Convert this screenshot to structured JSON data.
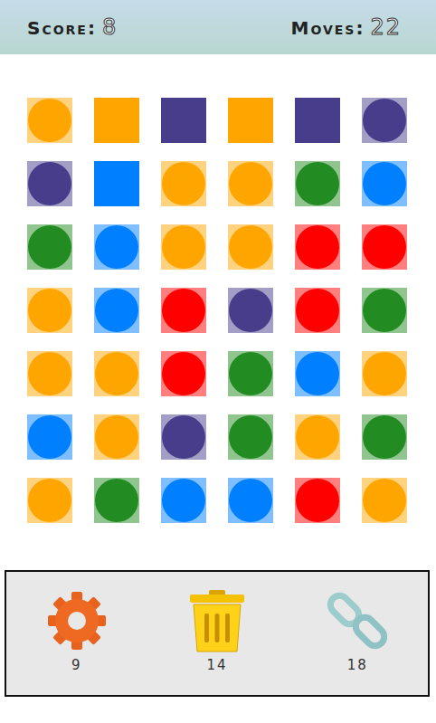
{
  "header": {
    "score": {
      "label": "Score:",
      "value": "8"
    },
    "moves": {
      "label": "Moves:",
      "value": "22"
    }
  },
  "board": {
    "rows": [
      [
        {
          "kind": "circle",
          "color": "#ffa500"
        },
        {
          "kind": "square",
          "color": "#ffa500"
        },
        {
          "kind": "square",
          "color": "#483d8b"
        },
        {
          "kind": "square",
          "color": "#ffa500"
        },
        {
          "kind": "square",
          "color": "#483d8b"
        },
        {
          "kind": "circle",
          "color": "#483d8b"
        }
      ],
      [
        {
          "kind": "circle",
          "color": "#483d8b"
        },
        {
          "kind": "square",
          "color": "#007fff"
        },
        {
          "kind": "circle",
          "color": "#ffa500"
        },
        {
          "kind": "circle",
          "color": "#ffa500"
        },
        {
          "kind": "circle",
          "color": "#228b22"
        },
        {
          "kind": "circle",
          "color": "#007fff"
        }
      ],
      [
        {
          "kind": "circle",
          "color": "#228b22"
        },
        {
          "kind": "circle",
          "color": "#007fff"
        },
        {
          "kind": "circle",
          "color": "#ffa500"
        },
        {
          "kind": "circle",
          "color": "#ffa500"
        },
        {
          "kind": "circle",
          "color": "#ff0000"
        },
        {
          "kind": "circle",
          "color": "#ff0000"
        }
      ],
      [
        {
          "kind": "circle",
          "color": "#ffa500"
        },
        {
          "kind": "circle",
          "color": "#007fff"
        },
        {
          "kind": "circle",
          "color": "#ff0000"
        },
        {
          "kind": "circle",
          "color": "#483d8b"
        },
        {
          "kind": "circle",
          "color": "#ff0000"
        },
        {
          "kind": "circle",
          "color": "#228b22"
        }
      ],
      [
        {
          "kind": "circle",
          "color": "#ffa500"
        },
        {
          "kind": "circle",
          "color": "#ffa500"
        },
        {
          "kind": "circle",
          "color": "#ff0000"
        },
        {
          "kind": "circle",
          "color": "#228b22"
        },
        {
          "kind": "circle",
          "color": "#007fff"
        },
        {
          "kind": "circle",
          "color": "#ffa500"
        }
      ],
      [
        {
          "kind": "circle",
          "color": "#007fff"
        },
        {
          "kind": "circle",
          "color": "#ffa500"
        },
        {
          "kind": "circle",
          "color": "#483d8b"
        },
        {
          "kind": "circle",
          "color": "#228b22"
        },
        {
          "kind": "circle",
          "color": "#ffa500"
        },
        {
          "kind": "circle",
          "color": "#228b22"
        }
      ],
      [
        {
          "kind": "circle",
          "color": "#ffa500"
        },
        {
          "kind": "circle",
          "color": "#228b22"
        },
        {
          "kind": "circle",
          "color": "#007fff"
        },
        {
          "kind": "circle",
          "color": "#007fff"
        },
        {
          "kind": "circle",
          "color": "#ff0000"
        },
        {
          "kind": "circle",
          "color": "#ffa500"
        }
      ]
    ]
  },
  "tools": [
    {
      "kind": "gear",
      "count": "9"
    },
    {
      "kind": "trash",
      "count": "14"
    },
    {
      "kind": "chain",
      "count": "18"
    }
  ]
}
